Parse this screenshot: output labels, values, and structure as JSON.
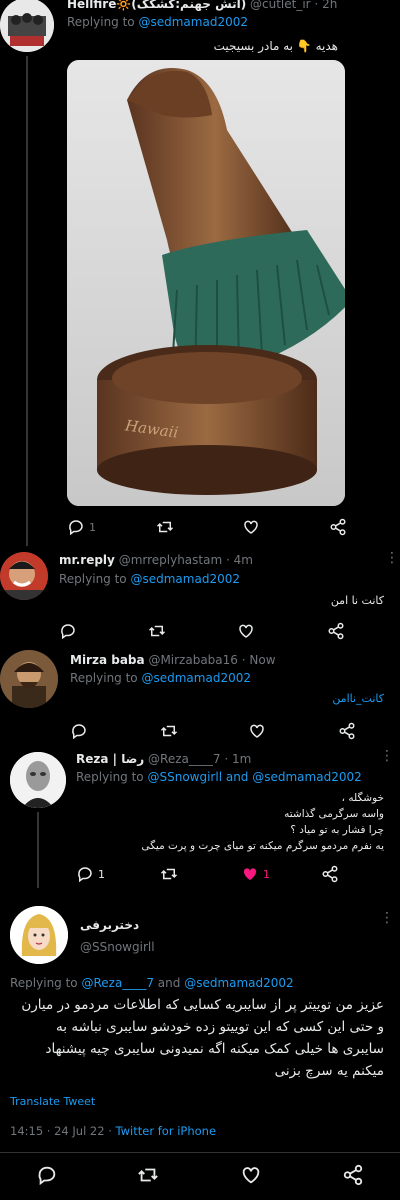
{
  "tweets": [
    {
      "name": "Hellfire🔆(آتش جهنم:کشکک)",
      "handle": "@cutlet_ir",
      "time": "· 2h",
      "reply_prefix": "Replying to",
      "reply_to": "@sedmamad2002",
      "text": "هدیه 👇 به مادر بسیجیت",
      "reply_count": "1",
      "image_caption": "Hawaii"
    },
    {
      "name": "mr.reply",
      "handle": "@mrreplyhastam",
      "time": "· 4m",
      "reply_prefix": "Replying to",
      "reply_to": "@sedmamad2002",
      "text": "کانت نا امن"
    },
    {
      "name": "Mirza baba",
      "handle": "@Mirzababa16",
      "time": "· Now",
      "reply_prefix": "Replying to",
      "reply_to": "@sedmamad2002",
      "text": "کانت_ناامن"
    },
    {
      "name": "Reza | رضا",
      "handle": "@Reza____7",
      "time": "· 1m",
      "reply_prefix": "Replying to",
      "reply_to": "@SSnowgirll and @sedmamad2002",
      "text_lines": [
        "خوشگله ،",
        "واسه سرگرمی گذاشته",
        "چرا فشار به تو میاد ؟",
        "یه نفرم مردمو سرگرم میکنه تو میای چرت و پرت میگی"
      ],
      "reply_count": "1",
      "like_count": "1"
    }
  ],
  "main_tweet": {
    "name": "دختربرفی",
    "handle": "@SSnowgirll",
    "reply_prefix": "Replying to",
    "reply_to_1": "@Reza____7",
    "reply_and": "and",
    "reply_to_2": "@sedmamad2002",
    "text": "عزیز من توییتر پر از سایبریه کسایی که اطلاعات مردمو در میارن و حتی این کسی که این توییتو زده خودشو سایبری نباشه به سایبری ها خیلی کمک میکنه اگه نمیدونی سایبری چیه پیشنهاد میکنم یه سرچ بزنی",
    "translate": "Translate Tweet",
    "timestamp": "14:15 · 24 Jul 22 ·",
    "source": "Twitter for iPhone"
  },
  "icons": [
    "reply-icon",
    "retweet-icon",
    "like-icon",
    "share-icon",
    "more-icon"
  ],
  "colors": {
    "background": "#000000",
    "link": "#1d9bf0",
    "muted": "#71767b",
    "like_active": "#f91880"
  }
}
